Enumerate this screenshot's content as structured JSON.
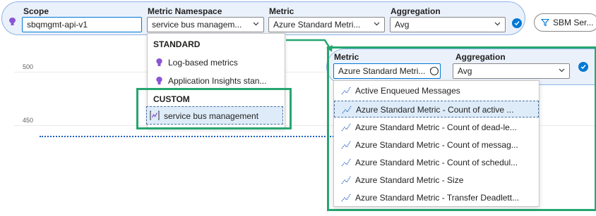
{
  "chart": {
    "y_ticks": [
      "500",
      "450"
    ]
  },
  "scope": {
    "label": "Scope",
    "value": "sbqmgmt-api-v1"
  },
  "namespace": {
    "label": "Metric Namespace",
    "value": "service bus managem...",
    "menu": {
      "standard_header": "STANDARD",
      "standard_items": [
        "Log-based metrics",
        "Application Insights stan..."
      ],
      "custom_header": "CUSTOM",
      "custom_items": [
        "service bus management"
      ]
    }
  },
  "metric": {
    "label": "Metric",
    "value": "Azure Standard Metri...",
    "zoom_value": "Azure Standard Metri..."
  },
  "aggregation": {
    "label": "Aggregation",
    "value": "Avg"
  },
  "filter": {
    "label": "SBM Ser..."
  },
  "metric_menu": {
    "items": [
      "Active Enqueued Messages",
      "Azure Standard Metric - Count of active ...",
      "Azure Standard Metric - Count of dead-le...",
      "Azure Standard Metric - Count of messag...",
      "Azure Standard Metric - Count of schedul...",
      "Azure Standard Metric - Size",
      "Azure Standard Metric - Transfer Deadlett..."
    ],
    "selected_index": 1
  },
  "colors": {
    "accent": "#0078d4",
    "highlight_green": "#26a671",
    "pill_bg": "#eaf1fb",
    "bulb_purple": "#8a55d4"
  }
}
